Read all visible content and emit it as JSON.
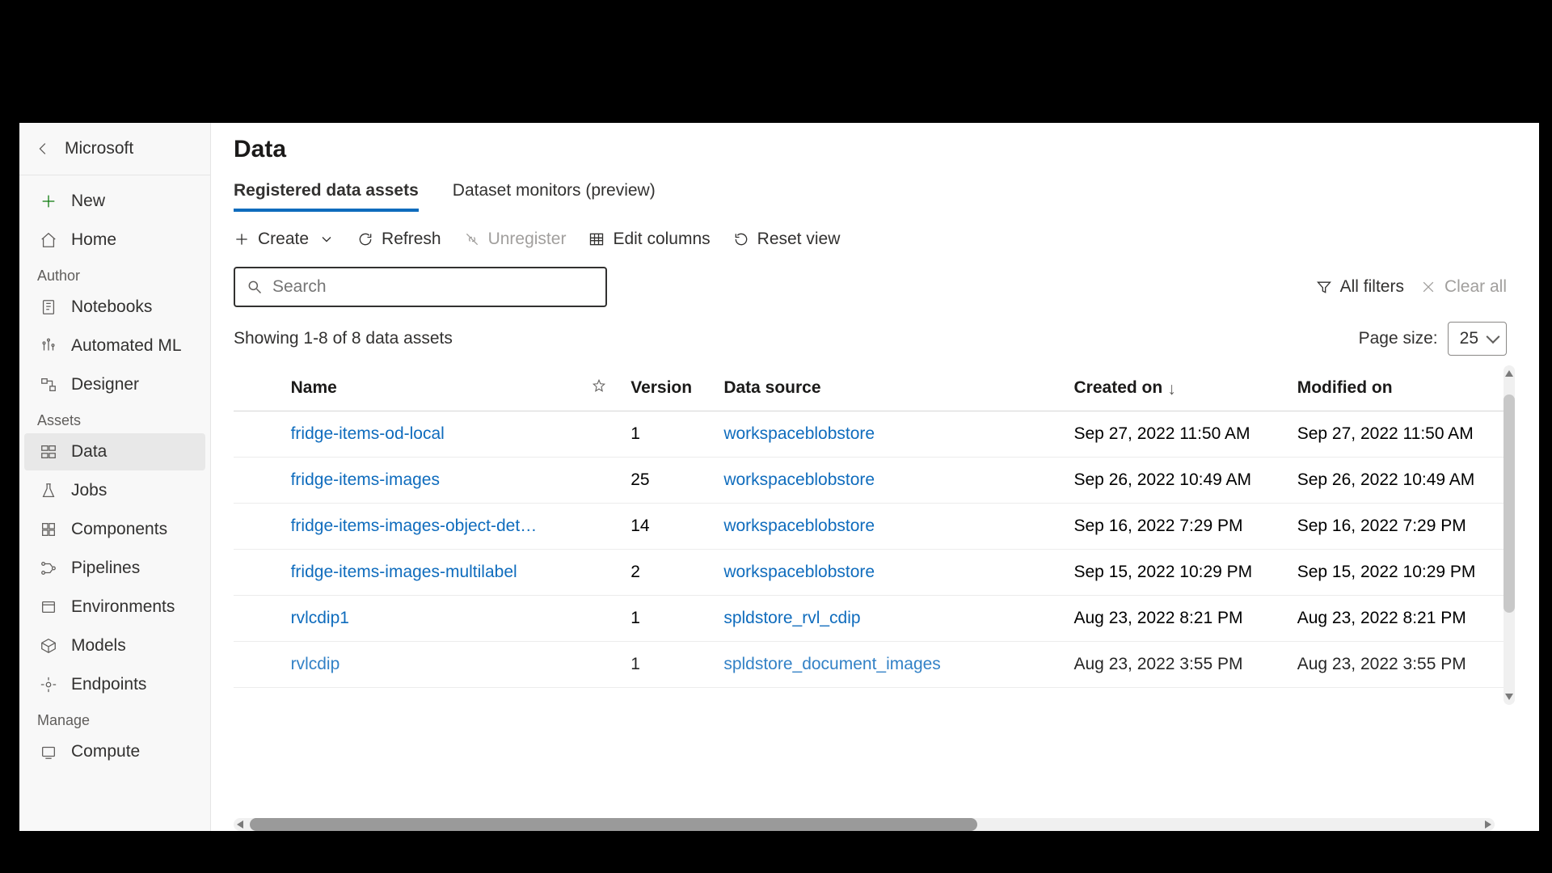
{
  "sidebar": {
    "back_label": "Microsoft",
    "new_label": "New",
    "home_label": "Home",
    "section_author": "Author",
    "notebooks": "Notebooks",
    "automl": "Automated ML",
    "designer": "Designer",
    "section_assets": "Assets",
    "data": "Data",
    "jobs": "Jobs",
    "components": "Components",
    "pipelines": "Pipelines",
    "environments": "Environments",
    "models": "Models",
    "endpoints": "Endpoints",
    "section_manage": "Manage",
    "compute": "Compute"
  },
  "header": {
    "title": "Data"
  },
  "tabs": {
    "registered": "Registered data assets",
    "monitors": "Dataset monitors (preview)"
  },
  "toolbar": {
    "create": "Create",
    "refresh": "Refresh",
    "unregister": "Unregister",
    "edit_columns": "Edit columns",
    "reset_view": "Reset view"
  },
  "search": {
    "placeholder": "Search"
  },
  "filters": {
    "all_filters": "All filters",
    "clear_all": "Clear all"
  },
  "list_meta": {
    "showing": "Showing 1-8 of 8 data assets",
    "page_size_label": "Page size:",
    "page_size_value": "25"
  },
  "columns": {
    "name": "Name",
    "version": "Version",
    "data_source": "Data source",
    "created_on": "Created on",
    "modified_on": "Modified on"
  },
  "rows": [
    {
      "name": "fridge-items-od-local",
      "version": "1",
      "data_source": "workspaceblobstore",
      "created": "Sep 27, 2022 11:50 AM",
      "modified": "Sep 27, 2022 11:50 AM"
    },
    {
      "name": "fridge-items-images",
      "version": "25",
      "data_source": "workspaceblobstore",
      "created": "Sep 26, 2022 10:49 AM",
      "modified": "Sep 26, 2022 10:49 AM"
    },
    {
      "name": "fridge-items-images-object-det…",
      "version": "14",
      "data_source": "workspaceblobstore",
      "created": "Sep 16, 2022 7:29 PM",
      "modified": "Sep 16, 2022 7:29 PM"
    },
    {
      "name": "fridge-items-images-multilabel",
      "version": "2",
      "data_source": "workspaceblobstore",
      "created": "Sep 15, 2022 10:29 PM",
      "modified": "Sep 15, 2022 10:29 PM"
    },
    {
      "name": "rvlcdip1",
      "version": "1",
      "data_source": "spldstore_rvl_cdip",
      "created": "Aug 23, 2022 8:21 PM",
      "modified": "Aug 23, 2022 8:21 PM"
    },
    {
      "name": "rvlcdip",
      "version": "1",
      "data_source": "spldstore_document_images",
      "created": "Aug 23, 2022 3:55 PM",
      "modified": "Aug 23, 2022 3:55 PM"
    }
  ]
}
